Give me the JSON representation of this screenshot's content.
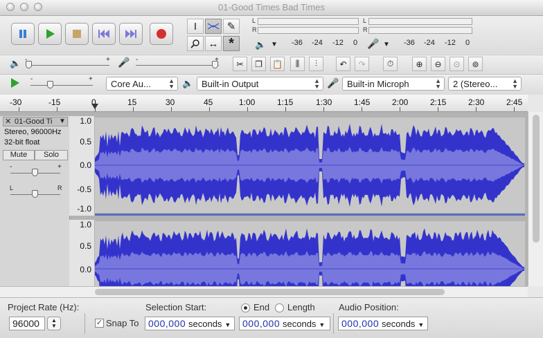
{
  "window": {
    "title": "01-Good Times Bad Times"
  },
  "meters": {
    "playback_ticks": [
      "-36",
      "-24",
      "-12",
      "0"
    ],
    "record_ticks": [
      "-36",
      "-24",
      "-12",
      "0"
    ],
    "channel_left": "L",
    "channel_right": "R"
  },
  "mixer": {
    "plus": "+",
    "minus": "-"
  },
  "device": {
    "host": "Core Au...",
    "output": "Built-in Output",
    "input": "Built-in Microph",
    "channels": "2 (Stereo..."
  },
  "ruler": {
    "labels": [
      "-30",
      "-15",
      "0",
      "15",
      "30",
      "45",
      "1:00",
      "1:15",
      "1:30",
      "1:45",
      "2:00",
      "2:15",
      "2:30",
      "2:45"
    ]
  },
  "track": {
    "name": "01-Good Ti",
    "info1": "Stereo, 96000Hz",
    "info2": "32-bit float",
    "mute": "Mute",
    "solo": "Solo",
    "pan_left": "L",
    "pan_right": "R",
    "gain_minus": "-",
    "gain_plus": "+",
    "scale_top": [
      "1.0",
      "0.5",
      "0.0",
      "-0.5",
      "-1.0"
    ],
    "scale_bottom": [
      "1.0",
      "0.5",
      "0.0"
    ]
  },
  "selection": {
    "project_rate_label": "Project Rate (Hz):",
    "project_rate_value": "96000",
    "snap_to": "Snap To",
    "selection_start_label": "Selection Start:",
    "end_label": "End",
    "length_label": "Length",
    "audio_position_label": "Audio Position:",
    "start_value": "000,000",
    "end_value": "000,000",
    "position_value": "000,000",
    "unit": "seconds"
  },
  "colors": {
    "wave_dark": "#3333cc",
    "wave_light": "#7777dd",
    "wave_bg": "#c8c8c8"
  }
}
